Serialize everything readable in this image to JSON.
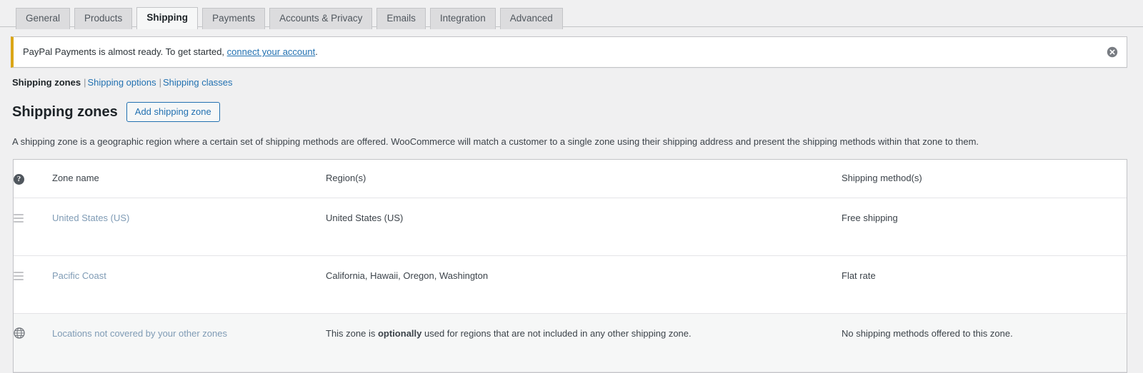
{
  "tabs": [
    {
      "label": "General",
      "active": false
    },
    {
      "label": "Products",
      "active": false
    },
    {
      "label": "Shipping",
      "active": true
    },
    {
      "label": "Payments",
      "active": false
    },
    {
      "label": "Accounts & Privacy",
      "active": false
    },
    {
      "label": "Emails",
      "active": false
    },
    {
      "label": "Integration",
      "active": false
    },
    {
      "label": "Advanced",
      "active": false
    }
  ],
  "notice": {
    "text_before": "PayPal Payments is almost ready. To get started, ",
    "link_label": "connect your account",
    "text_after": ".",
    "dismiss_icon": "close-circle-icon",
    "accent_color": "#dba617"
  },
  "subnav": {
    "current_label": "Shipping zones",
    "separator": "|",
    "links": [
      {
        "label": "Shipping options"
      },
      {
        "label": "Shipping classes"
      }
    ]
  },
  "header": {
    "page_title": "Shipping zones",
    "add_button_label": "Add shipping zone",
    "description": "A shipping zone is a geographic region where a certain set of shipping methods are offered. WooCommerce will match a customer to a single zone using their shipping address and present the shipping methods within that zone to them."
  },
  "table": {
    "help_icon_label": "?",
    "columns": {
      "handle": "",
      "zone_name": "Zone name",
      "regions": "Region(s)",
      "methods": "Shipping method(s)"
    },
    "rows": [
      {
        "handle_icon": "drag-handle-icon",
        "zone_name": "United States (US)",
        "regions": "United States (US)",
        "methods": "Free shipping",
        "is_rest_of_world": false
      },
      {
        "handle_icon": "drag-handle-icon",
        "zone_name": "Pacific Coast",
        "regions": "California, Hawaii, Oregon, Washington",
        "methods": "Flat rate",
        "is_rest_of_world": false
      },
      {
        "handle_icon": "globe-icon",
        "zone_name": "Locations not covered by your other zones",
        "regions_before": "This zone is ",
        "regions_bold": "optionally",
        "regions_after": " used for regions that are not included in any other shipping zone.",
        "methods": "No shipping methods offered to this zone.",
        "is_rest_of_world": true
      }
    ]
  },
  "colors": {
    "link": "#2271b1",
    "zone_link": "#7f9bb5",
    "page_bg": "#f0f0f1",
    "notice_accent": "#dba617"
  }
}
